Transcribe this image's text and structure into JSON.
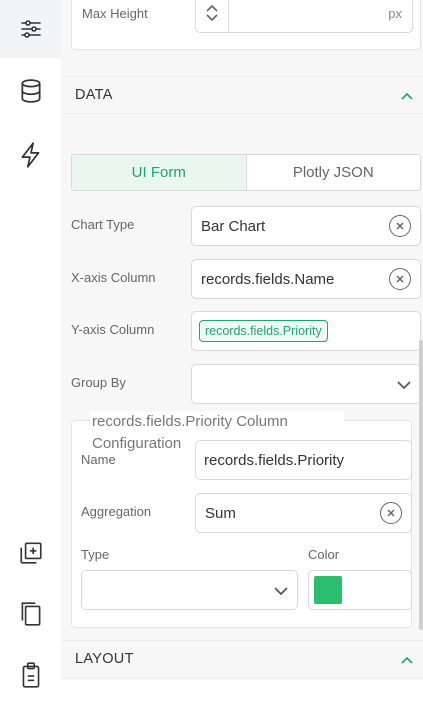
{
  "sidebar": {
    "icons": [
      "sliders-icon",
      "database-icon",
      "lightning-icon",
      "add-copy-icon",
      "copy-icon",
      "clipboard-icon"
    ]
  },
  "top_field": {
    "label": "Max Height",
    "unit": "px",
    "value": ""
  },
  "data_section": {
    "title": "DATA",
    "tabs": [
      {
        "label": "UI Form",
        "active": true
      },
      {
        "label": "Plotly JSON",
        "active": false
      }
    ],
    "chart_type": {
      "label": "Chart Type",
      "value": "Bar Chart"
    },
    "x_axis": {
      "label": "X-axis Column",
      "value": "records.fields.Name"
    },
    "y_axis": {
      "label": "Y-axis Column",
      "tag": "records.fields.Priority"
    },
    "group_by": {
      "label": "Group By",
      "value": ""
    },
    "column_config": {
      "title": "records.fields.Priority Column Configuration",
      "name": {
        "label": "Name",
        "value": "records.fields.Priority"
      },
      "aggregation": {
        "label": "Aggregation",
        "value": "Sum"
      },
      "type": {
        "label": "Type",
        "value": ""
      },
      "color": {
        "label": "Color",
        "value": "#2dbd6e"
      }
    }
  },
  "layout_section": {
    "title": "LAYOUT"
  },
  "colors": {
    "accent": "#22a06b",
    "swatch": "#2dbd6e"
  }
}
